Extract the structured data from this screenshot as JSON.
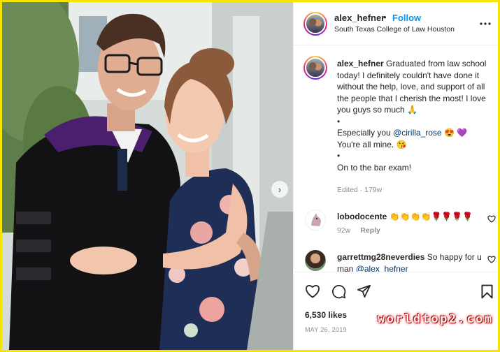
{
  "post": {
    "username": "alex_hefner",
    "separator": "•",
    "follow_label": "Follow",
    "location": "South Texas College of Law Houston",
    "more_icon": "more-horizontal-icon",
    "carousel_next_glyph": "›"
  },
  "caption": {
    "username": "alex_hefner",
    "line1": "Graduated from law school today! I definitely couldn't have done it without the help, love, and support of all the people that I cherish the most! I love you guys so much 🙏",
    "bullet1": "•",
    "especially_prefix": "Especially you",
    "mention": "@cirilla_rose",
    "especially_suffix": "😍 💜",
    "line_mine": "You're all mine. 😘",
    "bullet2": "•",
    "line_bar": "On to the bar exam!",
    "meta": "Edited · 179w"
  },
  "comments": [
    {
      "username": "lobodocente",
      "text": "👏👏👏👏🌹🌹🌹🌹",
      "age": "92w",
      "reply_label": "Reply"
    },
    {
      "username": "garrettmg28neverdies",
      "text": "So happy for u man",
      "mention": "@alex_hefner"
    }
  ],
  "actions": {
    "likes": "6,530 likes",
    "date": "MAY 26, 2019"
  },
  "watermark": "worldtop2.com",
  "colors": {
    "accent": "#0095f6",
    "border_highlight": "#f5e300",
    "mention": "#00376b"
  }
}
